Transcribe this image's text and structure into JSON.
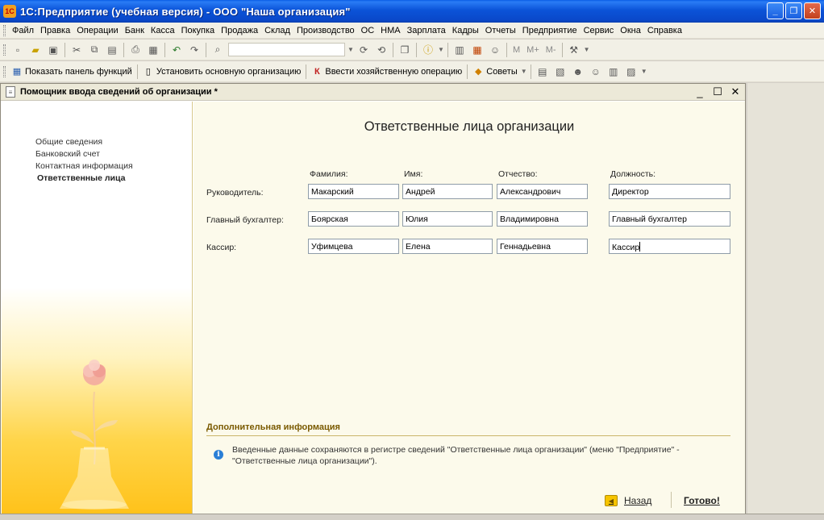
{
  "window": {
    "title": "1С:Предприятие (учебная версия) - ООО \"Наша организация\"",
    "app_icon": "1С"
  },
  "menu": {
    "items": [
      "Файл",
      "Правка",
      "Операции",
      "Банк",
      "Касса",
      "Покупка",
      "Продажа",
      "Склад",
      "Производство",
      "ОС",
      "НМА",
      "Зарплата",
      "Кадры",
      "Отчеты",
      "Предприятие",
      "Сервис",
      "Окна",
      "Справка"
    ]
  },
  "toolbar2": {
    "show_panel": "Показать панель функций",
    "set_main_org": "Установить основную организацию",
    "enter_operation": "Ввести хозяйственную операцию",
    "tips": "Советы",
    "m_buttons": [
      "M",
      "M+",
      "M-"
    ]
  },
  "document": {
    "title": "Помощник ввода сведений об организации *"
  },
  "steps": [
    "Общие сведения",
    "Банковский счет",
    "Контактная информация",
    "Ответственные лица"
  ],
  "form": {
    "title": "Ответственные лица организации",
    "columns": [
      "Фамилия:",
      "Имя:",
      "Отчество:",
      "Должность:"
    ],
    "rows": [
      {
        "label": "Руководитель:",
        "last": "Макарский",
        "first": "Андрей",
        "middle": "Александрович",
        "position": "Директор"
      },
      {
        "label": "Главный бухгалтер:",
        "last": "Боярская",
        "first": "Юлия",
        "middle": "Владимировна",
        "position": "Главный бухгалтер"
      },
      {
        "label": "Кассир:",
        "last": "Уфимцева",
        "first": "Елена",
        "middle": "Геннадьевна",
        "position": "Кассир"
      }
    ]
  },
  "additional": {
    "title": "Дополнительная информация",
    "text": "Введенные данные сохраняются в регистре сведений \"Ответственные лица организации\" (меню \"Предприятие\" - \"Ответственные лица организации\")."
  },
  "buttons": {
    "back": "Назад",
    "done": "Готово!"
  },
  "colors": {
    "titlebar": "#0a53d8",
    "accent_gold": "#ffc21a",
    "info_title": "#7a5a00"
  }
}
